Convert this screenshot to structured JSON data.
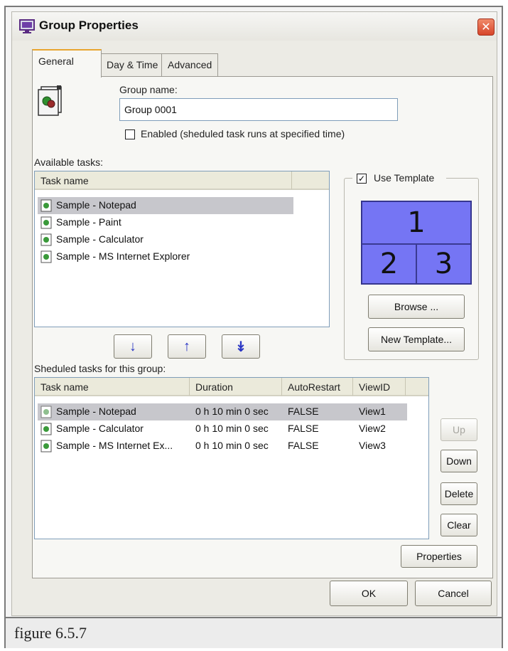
{
  "window": {
    "title": "Group Properties",
    "close_glyph": "✕"
  },
  "tabs": [
    {
      "label": "General",
      "active": true
    },
    {
      "label": "Day & Time",
      "active": false
    },
    {
      "label": "Advanced",
      "active": false
    }
  ],
  "general": {
    "group_name_label": "Group name:",
    "group_name_value": "Group 0001",
    "enabled_label": "Enabled (sheduled task runs at specified time)",
    "enabled_checked": false
  },
  "available_tasks": {
    "label": "Available tasks:",
    "column_header": "Task name",
    "items": [
      "Sample - Notepad",
      "Sample - Paint",
      "Sample - Calculator",
      "Sample - MS Internet Explorer"
    ],
    "selected_index": 0
  },
  "move_buttons": {
    "down_glyph": "↓",
    "up_glyph": "↑",
    "all_down_glyph": "↡"
  },
  "template": {
    "use_template_label": "Use Template",
    "use_template_checked": true,
    "cells": [
      "1",
      "2",
      "3"
    ],
    "browse_label": "Browse ...",
    "new_template_label": "New Template..."
  },
  "scheduled": {
    "label": "Sheduled tasks for this group:",
    "columns": [
      "Task name",
      "Duration",
      "AutoRestart",
      "ViewID"
    ],
    "rows": [
      {
        "task": "Sample - Notepad",
        "duration": "0 h 10 min 0 sec",
        "autorestart": "FALSE",
        "viewid": "View1"
      },
      {
        "task": "Sample - Calculator",
        "duration": "0 h 10 min 0 sec",
        "autorestart": "FALSE",
        "viewid": "View2"
      },
      {
        "task": "Sample - MS Internet Ex...",
        "duration": "0 h 10 min 0 sec",
        "autorestart": "FALSE",
        "viewid": "View3"
      }
    ],
    "selected_index": 0
  },
  "side_buttons": {
    "up": "Up",
    "down": "Down",
    "delete": "Delete",
    "clear": "Clear",
    "properties": "Properties"
  },
  "footer": {
    "ok": "OK",
    "cancel": "Cancel"
  },
  "caption": "figure 6.5.7",
  "colors": {
    "template_fill": "#7575f4",
    "arrow_color": "#2a36c4",
    "close_button": "#d7452a"
  },
  "icons": {
    "title": "group-properties-icon",
    "group": "task-group-icon",
    "task": "task-item-icon"
  }
}
